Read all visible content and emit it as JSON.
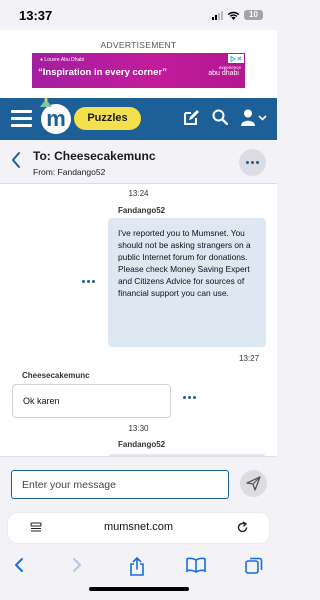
{
  "status_bar": {
    "time": "13:37",
    "battery": "10"
  },
  "ad": {
    "label": "ADVERTISEMENT",
    "location": "Louvre Abu Dhabi",
    "headline": "“Inspiration in every corner”",
    "brand_top": "experience",
    "brand": "abu dhabi"
  },
  "header": {
    "puzzles_label": "Puzzles",
    "accent": "#1d5f97",
    "pill_color": "#f4e04d"
  },
  "conversation": {
    "title": "To: Cheesecakemunc",
    "from": "From: Fandango52"
  },
  "messages": [
    {
      "time": "13:24",
      "sender": "Fandango52",
      "text": "I've reported you to Mumsnet. You should not be asking strangers on a public Internet forum for donations. Please check Money Saving Expert and Citizens Advice for sources of financial support you can use.",
      "after_time": "13:27"
    },
    {
      "sender": "Cheesecakemunc",
      "text": "Ok karen"
    },
    {
      "time": "13:30",
      "sender": "Fandango52"
    }
  ],
  "compose": {
    "placeholder": "Enter your message"
  },
  "browser": {
    "url": "mumsnet.com"
  }
}
